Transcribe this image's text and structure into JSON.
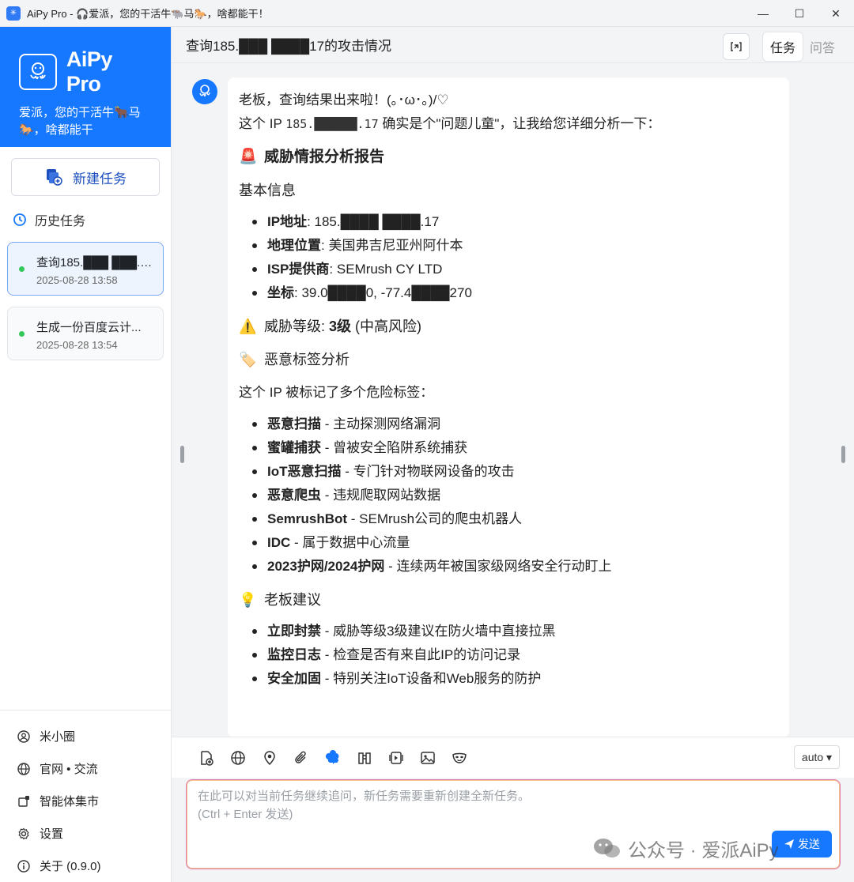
{
  "window": {
    "title": "AiPy Pro - 🎧爱派，您的干活牛🐃马🐎，啥都能干！",
    "controls": [
      "minimize",
      "maximize",
      "close"
    ]
  },
  "sidebar": {
    "brand_name": "AiPy Pro",
    "slogan_line1": "爱派，您的干活牛🐂马",
    "slogan_line2": "🐎，啥都能干",
    "new_task_label": "新建任务",
    "history_label": "历史任务",
    "tasks": [
      {
        "name": "查询185.███ ███.1...",
        "time": "2025-08-28 13:58",
        "active": true
      },
      {
        "name": "生成一份百度云计...",
        "time": "2025-08-28 13:54",
        "active": false
      }
    ],
    "bottom_links": [
      {
        "label": "米小圈",
        "icon": "user-circle-icon"
      },
      {
        "label": "官网 • 交流",
        "icon": "globe-icon"
      },
      {
        "label": "智能体集市",
        "icon": "store-icon"
      },
      {
        "label": "设置",
        "icon": "gear-icon"
      },
      {
        "label": "关于 (0.9.0)",
        "icon": "info-icon"
      }
    ]
  },
  "header": {
    "title": "查询185.███ ████17的攻击情况",
    "tab_task": "任务",
    "tab_qa": "问答"
  },
  "message": {
    "greeting": "老板，查询结果出来啦！(｡･ω･｡)/♡",
    "intro_prefix": "这个 IP ",
    "intro_ip": "185.██████.17",
    "intro_suffix": " 确实是个\"问题儿童\"，让我给您详细分析一下：",
    "report_title": "威胁情报分析报告",
    "basic_title": "基本信息",
    "basic": [
      {
        "k": "IP地址",
        "v": ": 185.████ ████.17"
      },
      {
        "k": "地理位置",
        "v": ": 美国弗吉尼亚州阿什本"
      },
      {
        "k": "ISP提供商",
        "v": ": SEMrush CY LTD"
      },
      {
        "k": "坐标",
        "v": ": 39.0████0, -77.4████270"
      }
    ],
    "threat_prefix": "威胁等级: ",
    "threat_level": "3级",
    "threat_suffix": " (中高风险)",
    "tags_title": "恶意标签分析",
    "tags_intro": "这个 IP 被标记了多个危险标签：",
    "tags": [
      {
        "k": "恶意扫描",
        "v": " - 主动探测网络漏洞"
      },
      {
        "k": "蜜罐捕获",
        "v": " - 曾被安全陷阱系统捕获"
      },
      {
        "k": "IoT恶意扫描",
        "v": " - 专门针对物联网设备的攻击"
      },
      {
        "k": "恶意爬虫",
        "v": " - 违规爬取网站数据"
      },
      {
        "k": "SemrushBot",
        "v": " - SEMrush公司的爬虫机器人"
      },
      {
        "k": "IDC",
        "v": " - 属于数据中心流量"
      },
      {
        "k": "2023护网/2024护网",
        "v": " - 连续两年被国家级网络安全行动盯上"
      }
    ],
    "advice_title": "老板建议",
    "advice": [
      {
        "k": "立即封禁",
        "v": " - 威胁等级3级建议在防火墙中直接拉黑"
      },
      {
        "k": "监控日志",
        "v": " - 检查是否有来自此IP的访问记录"
      },
      {
        "k": "安全加固",
        "v": " - 特别关注IoT设备和Web服务的防护"
      }
    ]
  },
  "composer": {
    "model_select": "auto",
    "placeholder": "在此可以对当前任务继续追问，新任务需要重新创建全新任务。",
    "hint": "(Ctrl + Enter 发送)",
    "send_label": "发送",
    "tools": [
      "upload-file-icon",
      "globe-icon",
      "location-icon",
      "attachment-icon",
      "brain-icon",
      "book-icon",
      "screen-icon",
      "image-icon",
      "mask-icon"
    ]
  },
  "watermark": "公众号 · 爱派AiPy",
  "colors": {
    "brand": "#1677ff",
    "active_dot": "#34c759",
    "input_border": "#e27ab0"
  }
}
